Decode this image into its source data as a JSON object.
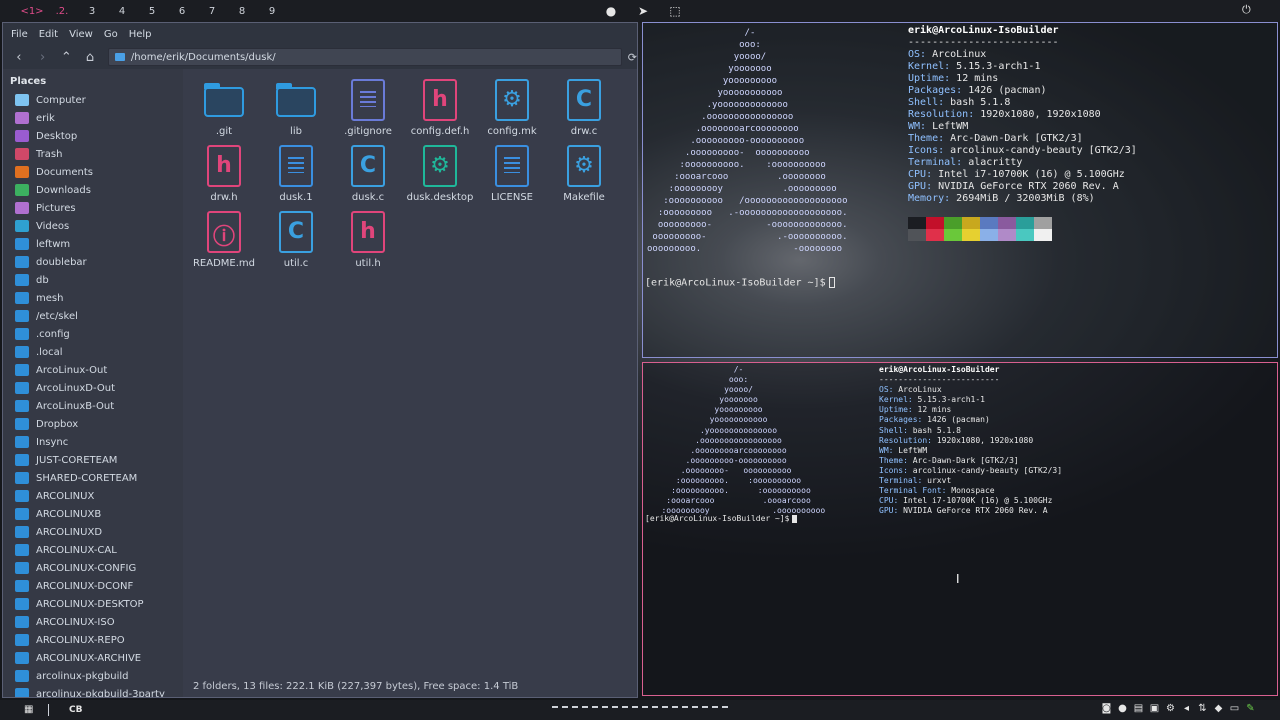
{
  "topbar": {
    "workspaces": [
      "<1>",
      ".2.",
      "3",
      "4",
      "5",
      "6",
      "7",
      "8",
      "9"
    ]
  },
  "filemanager": {
    "menu": [
      "File",
      "Edit",
      "View",
      "Go",
      "Help"
    ],
    "path": "/home/erik/Documents/dusk/",
    "places_title": "Places",
    "places": [
      {
        "label": "Computer",
        "icon": "computer-icon"
      },
      {
        "label": "erik",
        "icon": "home-icon"
      },
      {
        "label": "Desktop",
        "icon": "desktop-icon"
      },
      {
        "label": "Trash",
        "icon": "trash-icon"
      },
      {
        "label": "Documents",
        "icon": "documents-icon"
      },
      {
        "label": "Downloads",
        "icon": "downloads-icon"
      },
      {
        "label": "Pictures",
        "icon": "pictures-icon"
      },
      {
        "label": "Videos",
        "icon": "videos-icon"
      },
      {
        "label": "leftwm",
        "icon": "folder-icon"
      },
      {
        "label": "doublebar",
        "icon": "folder-icon"
      },
      {
        "label": "db",
        "icon": "folder-icon"
      },
      {
        "label": "mesh",
        "icon": "folder-icon"
      },
      {
        "label": "/etc/skel",
        "icon": "folder-icon"
      },
      {
        "label": ".config",
        "icon": "folder-icon"
      },
      {
        "label": ".local",
        "icon": "folder-icon"
      },
      {
        "label": "ArcoLinux-Out",
        "icon": "folder-icon"
      },
      {
        "label": "ArcoLinuxD-Out",
        "icon": "folder-icon"
      },
      {
        "label": "ArcoLinuxB-Out",
        "icon": "folder-icon"
      },
      {
        "label": "Dropbox",
        "icon": "folder-icon"
      },
      {
        "label": "Insync",
        "icon": "folder-icon"
      },
      {
        "label": "JUST-CORETEAM",
        "icon": "folder-icon"
      },
      {
        "label": "SHARED-CORETEAM",
        "icon": "folder-icon"
      },
      {
        "label": "ARCOLINUX",
        "icon": "folder-icon"
      },
      {
        "label": "ARCOLINUXB",
        "icon": "folder-icon"
      },
      {
        "label": "ARCOLINUXD",
        "icon": "folder-icon"
      },
      {
        "label": "ARCOLINUX-CAL",
        "icon": "folder-icon"
      },
      {
        "label": "ARCOLINUX-CONFIG",
        "icon": "folder-icon"
      },
      {
        "label": "ARCOLINUX-DCONF",
        "icon": "folder-icon"
      },
      {
        "label": "ARCOLINUX-DESKTOP",
        "icon": "folder-icon"
      },
      {
        "label": "ARCOLINUX-ISO",
        "icon": "folder-icon"
      },
      {
        "label": "ARCOLINUX-REPO",
        "icon": "folder-icon"
      },
      {
        "label": "ARCOLINUX-ARCHIVE",
        "icon": "folder-icon"
      },
      {
        "label": "arcolinux-pkgbuild",
        "icon": "folder-icon"
      },
      {
        "label": "arcolinux-pkgbuild-3party",
        "icon": "folder-icon"
      }
    ],
    "files": [
      {
        "name": ".git",
        "kind": "folder",
        "glyph": "",
        "color": "#2f9be0"
      },
      {
        "name": "lib",
        "kind": "folder",
        "glyph": "",
        "color": "#2f9be0"
      },
      {
        "name": ".gitignore",
        "kind": "text",
        "glyph": "",
        "color": "#6a7bd8"
      },
      {
        "name": "config.def.h",
        "kind": "code",
        "glyph": "h",
        "color": "#e0457b"
      },
      {
        "name": "config.mk",
        "kind": "gear",
        "glyph": "⚙",
        "color": "#3aa0e0"
      },
      {
        "name": "drw.c",
        "kind": "code",
        "glyph": "C",
        "color": "#3aa0e0"
      },
      {
        "name": "drw.h",
        "kind": "code",
        "glyph": "h",
        "color": "#e0457b"
      },
      {
        "name": "dusk.1",
        "kind": "text",
        "glyph": "",
        "color": "#3a8fe0"
      },
      {
        "name": "dusk.c",
        "kind": "code",
        "glyph": "C",
        "color": "#3aa0e0"
      },
      {
        "name": "dusk.desktop",
        "kind": "gear",
        "glyph": "⚙",
        "color": "#1fb89a"
      },
      {
        "name": "LICENSE",
        "kind": "text",
        "glyph": "",
        "color": "#3a8fe0"
      },
      {
        "name": "Makefile",
        "kind": "gear",
        "glyph": "⚙",
        "color": "#3aa0e0"
      },
      {
        "name": "README.md",
        "kind": "code",
        "glyph": "ⓘ",
        "color": "#e0457b"
      },
      {
        "name": "util.c",
        "kind": "code",
        "glyph": "C",
        "color": "#3aa0e0"
      },
      {
        "name": "util.h",
        "kind": "code",
        "glyph": "h",
        "color": "#e0457b"
      }
    ],
    "status": "2 folders, 13 files: 222.1 KiB (227,397 bytes), Free space: 1.4 TiB"
  },
  "terminal1": {
    "ascii": "                  /-\n                 ooo:\n                yoooo/\n               yooooooo\n              yooooooooo\n             yooooooooooo\n           .yooooooooooooo\n          .oooooooooooooooo\n         .oooooooarcoooooooo\n        .ooooooooo-oooooooooo\n       .ooooooooo-  oooooooooo\n      :oooooooooo.    :oooooooooo\n     :oooarcooo         .oooooooo\n    :ooooooooy           .ooooooooo\n   :oooooooooo   /ooooooooooooooooooo\n  :ooooooooo   .-ooooooooooooooooooo.\n  ooooooooo-          -ooooooooooooo.\n ooooooooo-             .-oooooooooo.\nooooooooo.                 -oooooooo",
    "title": "erik@ArcoLinux-IsoBuilder",
    "separator": "-------------------------",
    "lines": [
      {
        "key": "OS",
        "value": "ArcoLinux"
      },
      {
        "key": "Kernel",
        "value": "5.15.3-arch1-1"
      },
      {
        "key": "Uptime",
        "value": "12 mins"
      },
      {
        "key": "Packages",
        "value": "1426 (pacman)"
      },
      {
        "key": "Shell",
        "value": "bash 5.1.8"
      },
      {
        "key": "Resolution",
        "value": "1920x1080, 1920x1080"
      },
      {
        "key": "WM",
        "value": "LeftWM"
      },
      {
        "key": "Theme",
        "value": "Arc-Dawn-Dark [GTK2/3]"
      },
      {
        "key": "Icons",
        "value": "arcolinux-candy-beauty [GTK2/3]"
      },
      {
        "key": "Terminal",
        "value": "alacritty"
      },
      {
        "key": "CPU",
        "value": "Intel i7-10700K (16) @ 5.100GHz"
      },
      {
        "key": "GPU",
        "value": "NVIDIA GeForce RTX 2060 Rev. A"
      },
      {
        "key": "Memory",
        "value": "2694MiB / 32003MiB (8%)"
      }
    ],
    "palette_top": [
      "#1b1d22",
      "#c3102a",
      "#4a9e2a",
      "#c8a81e",
      "#5a7ac0",
      "#8a5a9e",
      "#2a9e9a",
      "#a0a0a0"
    ],
    "palette_bottom": [
      "#505358",
      "#e0304a",
      "#6ac83a",
      "#e6d030",
      "#8ab0e8",
      "#b08ac8",
      "#4ac8c0",
      "#f0f0f0"
    ],
    "prompt": "[erik@ArcoLinux-IsoBuilder ~]$"
  },
  "terminal2": {
    "ascii": "                  /-\n                 ooo:\n                yoooo/\n               yooooooo\n              yooooooooo\n             yooooooooooo\n           .yoooooooooooooo\n          .ooooooooooooooooo\n         .ooooooooarcoooooooo\n        .ooooooooo-oooooooooo\n       .oooooooo-   oooooooooo\n      :ooooooooo.    :oooooooooo\n     :oooooooooo.      :oooooooooo\n    :oooarcooo          .oooarcooo\n   :ooooooooy             .oooooooooo",
    "title": "erik@ArcoLinux-IsoBuilder",
    "separator": "-------------------------",
    "lines": [
      {
        "key": "OS",
        "value": "ArcoLinux"
      },
      {
        "key": "Kernel",
        "value": "5.15.3-arch1-1"
      },
      {
        "key": "Uptime",
        "value": "12 mins"
      },
      {
        "key": "Packages",
        "value": "1426 (pacman)"
      },
      {
        "key": "Shell",
        "value": "bash 5.1.8"
      },
      {
        "key": "Resolution",
        "value": "1920x1080, 1920x1080"
      },
      {
        "key": "WM",
        "value": "LeftWM"
      },
      {
        "key": "Theme",
        "value": "Arc-Dawn-Dark [GTK2/3]"
      },
      {
        "key": "Icons",
        "value": "arcolinux-candy-beauty [GTK2/3]"
      },
      {
        "key": "Terminal",
        "value": "urxvt"
      },
      {
        "key": "Terminal Font",
        "value": "Monospace"
      },
      {
        "key": "CPU",
        "value": "Intel i7-10700K (16) @ 5.100GHz"
      },
      {
        "key": "GPU",
        "value": "NVIDIA GeForce RTX 2060 Rev. A"
      }
    ],
    "prompt": "[erik@ArcoLinux-IsoBuilder ~]$"
  },
  "bottombar": {
    "label": "CB"
  },
  "colors": {
    "accent": "#e04c8a",
    "term1_border": "#8a8fd0",
    "term2_border": "#d86090",
    "folder": "#2f9be0"
  }
}
